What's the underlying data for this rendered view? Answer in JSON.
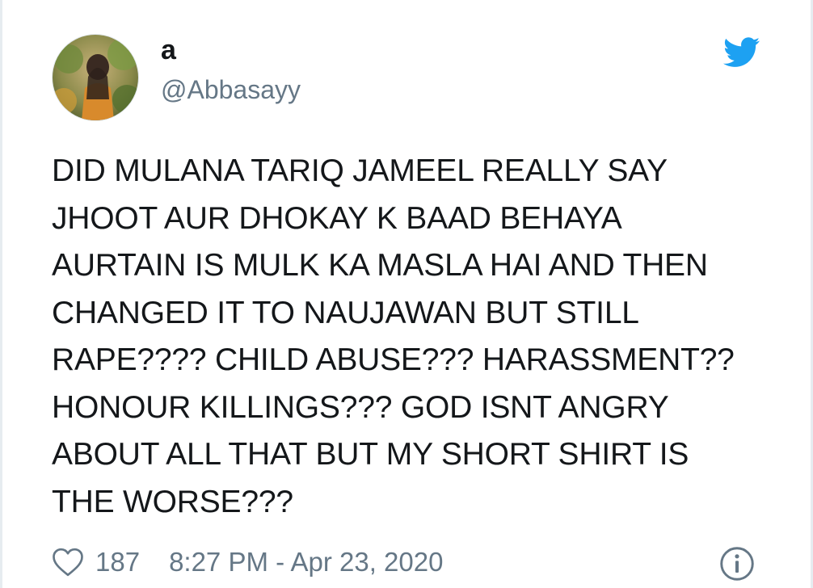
{
  "tweet": {
    "display_name": "a",
    "handle": "@Abbasayy",
    "text": "DID MULANA TARIQ JAMEEL REALLY SAY\nJHOOT AUR DHOKAY K BAAD BEHAYA\nAURTAIN IS MULK KA MASLA HAI AND THEN\nCHANGED IT TO NAUJAWAN BUT STILL\nRAPE???? CHILD ABUSE??? HARASSMENT??\nHONOUR KILLINGS??? GOD ISNT ANGRY\nABOUT ALL THAT BUT MY SHORT SHIRT IS\nTHE WORSE???",
    "likes": "187",
    "timestamp": "8:27 PM - Apr 23, 2020"
  },
  "icons": {
    "brand": "twitter-bird-icon",
    "like": "heart-icon",
    "info": "info-icon"
  },
  "colors": {
    "brand_blue": "#1da1f2",
    "text_primary": "#14171a",
    "text_secondary": "#657786"
  }
}
